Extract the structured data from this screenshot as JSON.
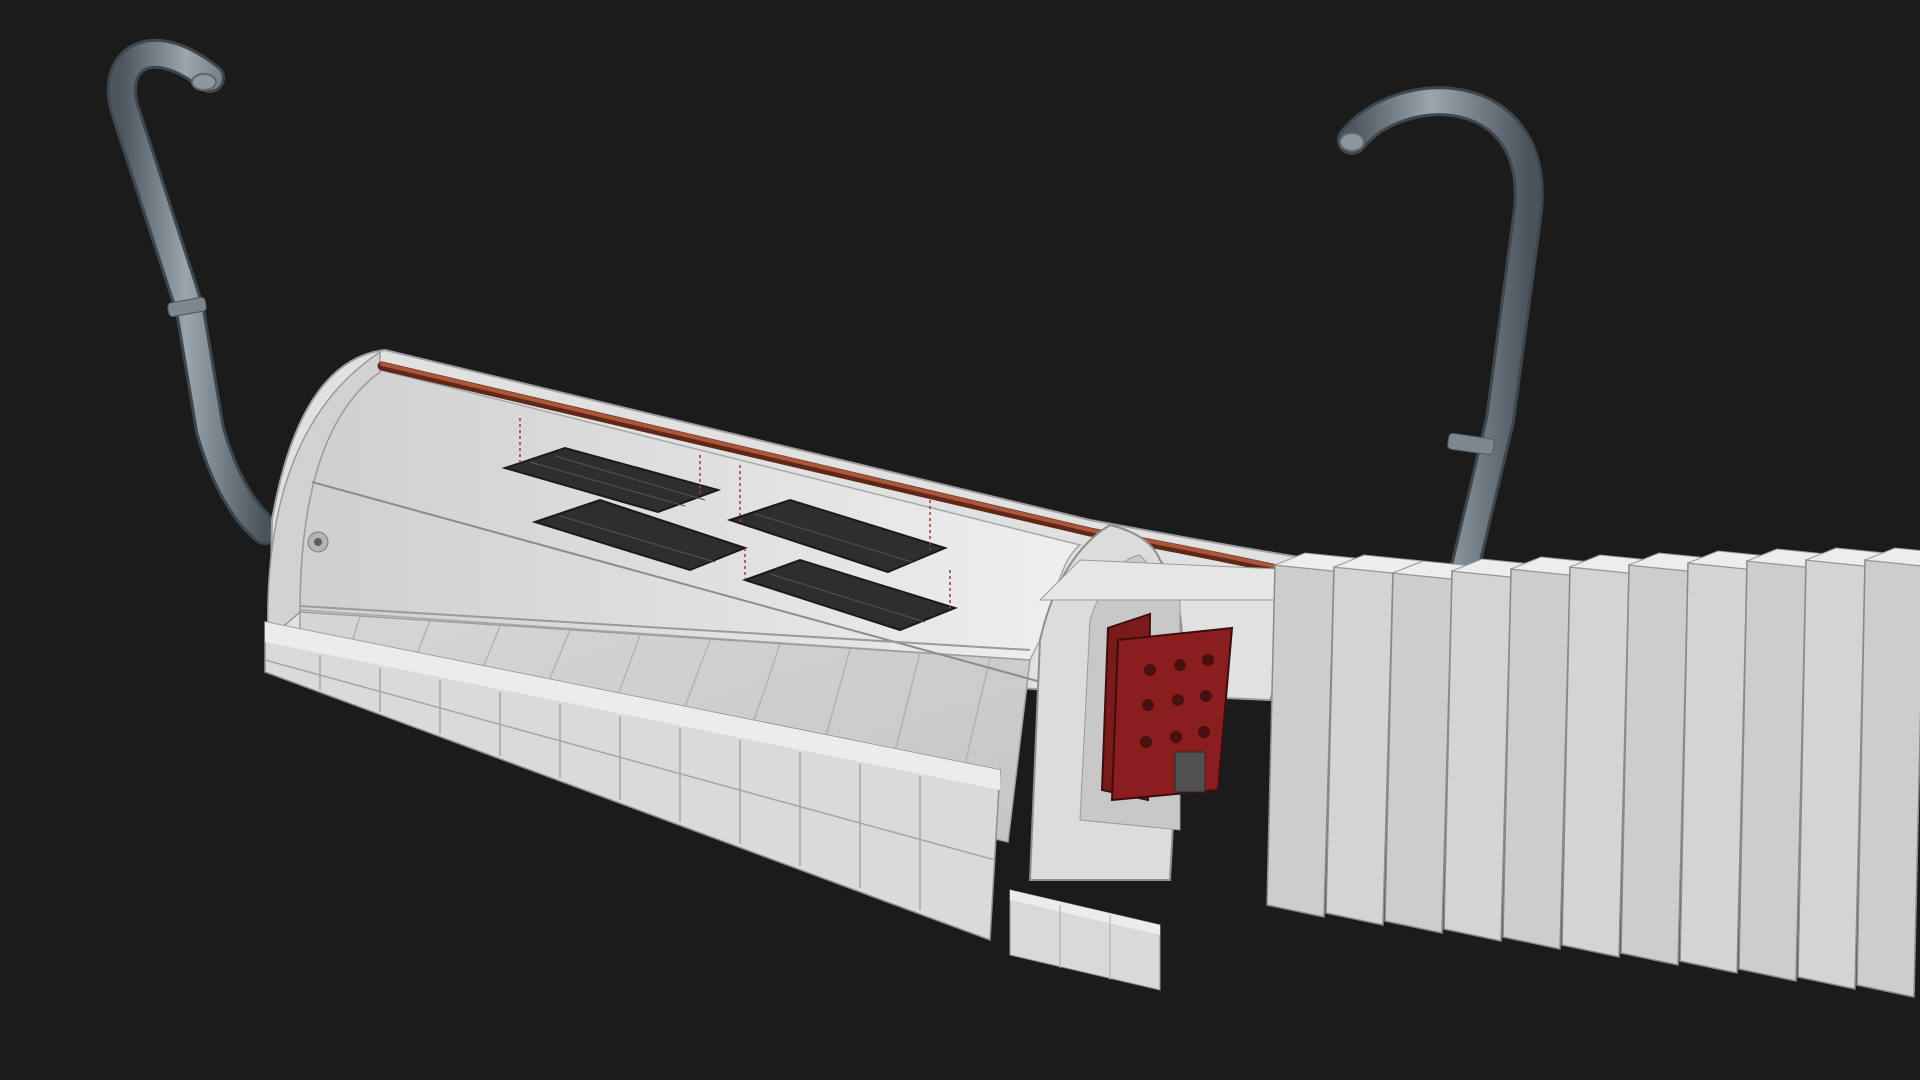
{
  "scene": {
    "subject": "bunker-cutaway-model",
    "background_color": "#1b1b1b",
    "concrete_color": "#e3e3e3",
    "concrete_shade_color": "#b9b9b9",
    "pipe_color": "#6e7982",
    "door_color": "#8a1d1d",
    "rail_pipe_color": "#8b3a24",
    "grate_color": "#2e2e2e",
    "stair_count": 11,
    "grate_count": 4
  }
}
